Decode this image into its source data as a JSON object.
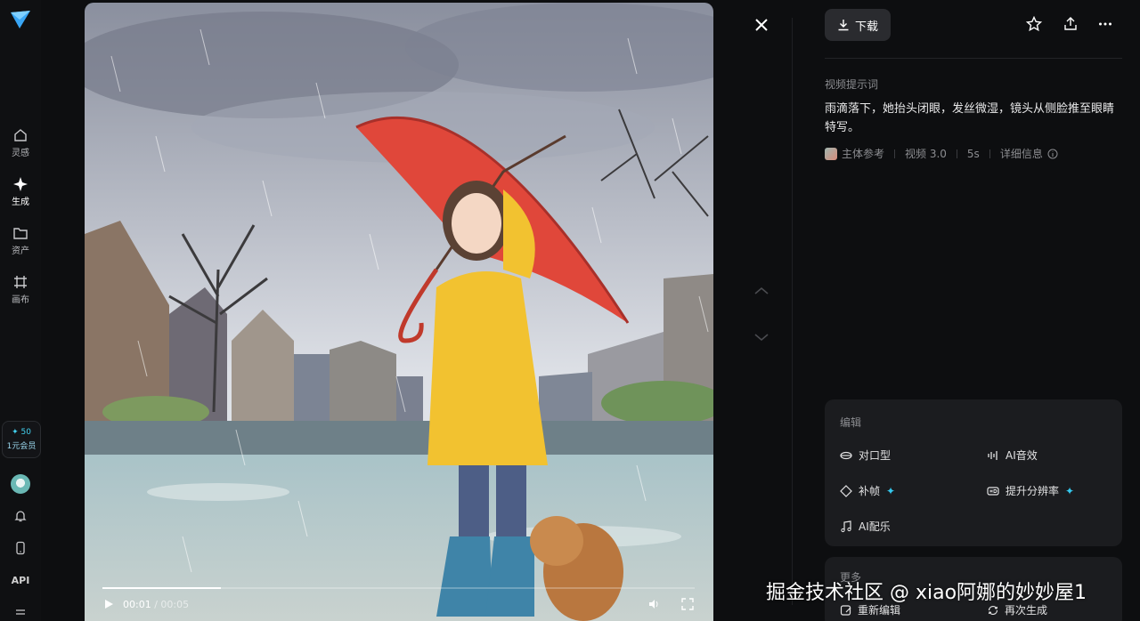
{
  "nav": {
    "items": [
      {
        "label": "灵感",
        "icon": "home-icon"
      },
      {
        "label": "生成",
        "icon": "sparkle-icon"
      },
      {
        "label": "资产",
        "icon": "folder-icon"
      },
      {
        "label": "画布",
        "icon": "canvas-icon"
      }
    ],
    "credits": "50",
    "membership": "1元会员",
    "api": "API"
  },
  "player": {
    "current_time": "00:01",
    "duration": "/ 00:05",
    "progress": 0.2
  },
  "toolbar": {
    "download_label": "下载"
  },
  "prompt": {
    "label": "视频提示词",
    "text": "雨滴落下，她抬头闭眼，发丝微湿，镜头从侧脸推至眼睛特写。"
  },
  "meta": {
    "reference": "主体参考",
    "model": "视频 3.0",
    "length": "5s",
    "details": "详细信息"
  },
  "edit": {
    "title": "编辑",
    "tools": [
      {
        "label": "对口型",
        "icon": "lips-icon",
        "badge": ""
      },
      {
        "label": "AI音效",
        "icon": "audio-wave-icon",
        "badge": ""
      },
      {
        "label": "补帧",
        "icon": "frame-icon",
        "badge": "✦"
      },
      {
        "label": "提升分辨率",
        "icon": "hd-icon",
        "badge": "✦"
      },
      {
        "label": "AI配乐",
        "icon": "music-icon",
        "badge": ""
      }
    ]
  },
  "more": {
    "title": "更多",
    "reedit": "重新编辑",
    "regenerate": "再次生成"
  },
  "watermark": "掘金技术社区 @ xiao阿娜的妙妙屋1",
  "colors": {
    "accent": "#34c8ee",
    "background": "#0d0e10",
    "card": "#1b1c1f",
    "coat": "#f2c230",
    "umbrella": "#e0473a"
  }
}
